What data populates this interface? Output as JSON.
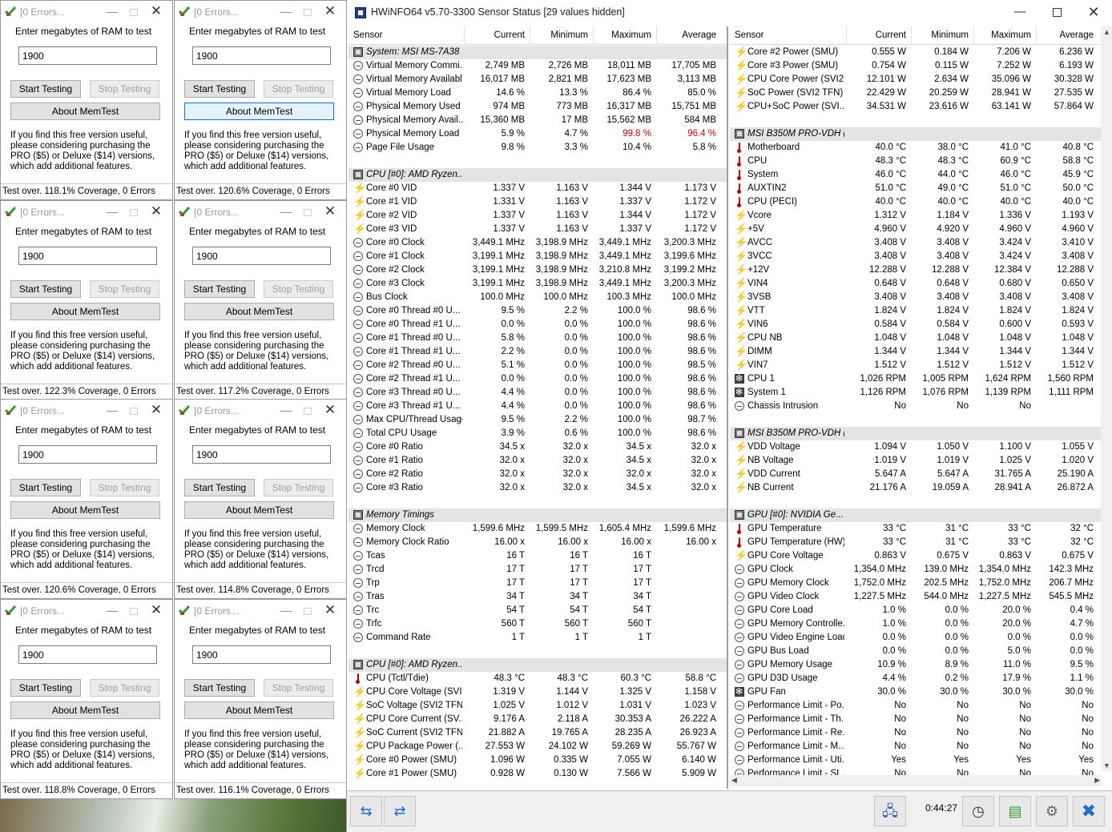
{
  "memtest": {
    "title": "[0 Errors...",
    "ram_label": "Enter megabytes of RAM to test",
    "ram_value": "1900",
    "start_label": "Start Testing",
    "stop_label": "Stop Testing",
    "about_label": "About MemTest",
    "info_text": "If you find this free version useful, please considering purchasing the PRO ($5) or Deluxe ($14) versions, which add additional features.",
    "windows": [
      {
        "status": "Test over. 118.1% Coverage, 0 Errors"
      },
      {
        "status": "Test over. 120.6% Coverage, 0 Errors"
      },
      {
        "status": "Test over. 122.3% Coverage, 0 Errors"
      },
      {
        "status": "Test over. 117.2% Coverage, 0 Errors"
      },
      {
        "status": "Test over. 120.6% Coverage, 0 Errors"
      },
      {
        "status": "Test over. 114.8% Coverage, 0 Errors"
      },
      {
        "status": "Test over. 118.8% Coverage, 0 Errors"
      },
      {
        "status": "Test over. 116.1% Coverage, 0 Errors"
      }
    ]
  },
  "hwinfo": {
    "title": "HWiNFO64 v5.70-3300 Sensor Status [29 values hidden]",
    "columns": [
      "Sensor",
      "Current",
      "Minimum",
      "Maximum",
      "Average"
    ],
    "elapsed": "0:44:27",
    "left_rows": [
      {
        "type": "group",
        "name": "System: MSI MS-7A38"
      },
      {
        "icon": "clock",
        "name": "Virtual Memory Commi...",
        "cur": "2,749 MB",
        "min": "2,726 MB",
        "max": "18,011 MB",
        "avg": "17,705 MB"
      },
      {
        "icon": "clock",
        "name": "Virtual Memory Available",
        "cur": "16,017 MB",
        "min": "2,821 MB",
        "max": "17,623 MB",
        "avg": "3,113 MB"
      },
      {
        "icon": "clock",
        "name": "Virtual Memory Load",
        "cur": "14.6 %",
        "min": "13.3 %",
        "max": "86.4 %",
        "avg": "85.0 %"
      },
      {
        "icon": "clock",
        "name": "Physical Memory Used",
        "cur": "974 MB",
        "min": "773 MB",
        "max": "16,317 MB",
        "avg": "15,751 MB"
      },
      {
        "icon": "clock",
        "name": "Physical Memory Avail...",
        "cur": "15,360 MB",
        "min": "17 MB",
        "max": "15,562 MB",
        "avg": "584 MB"
      },
      {
        "icon": "clock",
        "name": "Physical Memory Load",
        "cur": "5.9 %",
        "min": "4.7 %",
        "max": "99.8 %",
        "avg": "96.4 %",
        "red": true
      },
      {
        "icon": "clock",
        "name": "Page File Usage",
        "cur": "9.8 %",
        "min": "3.3 %",
        "max": "10.4 %",
        "avg": "5.8 %"
      },
      {
        "type": "blank"
      },
      {
        "type": "group",
        "name": "CPU [#0]: AMD Ryzen..."
      },
      {
        "icon": "bolt",
        "name": "Core #0 VID",
        "cur": "1.337 V",
        "min": "1.163 V",
        "max": "1.344 V",
        "avg": "1.173 V"
      },
      {
        "icon": "bolt",
        "name": "Core #1 VID",
        "cur": "1.331 V",
        "min": "1.163 V",
        "max": "1.337 V",
        "avg": "1.172 V"
      },
      {
        "icon": "bolt",
        "name": "Core #2 VID",
        "cur": "1.337 V",
        "min": "1.163 V",
        "max": "1.344 V",
        "avg": "1.172 V"
      },
      {
        "icon": "bolt",
        "name": "Core #3 VID",
        "cur": "1.337 V",
        "min": "1.163 V",
        "max": "1.337 V",
        "avg": "1.172 V"
      },
      {
        "icon": "clock",
        "name": "Core #0 Clock",
        "cur": "3,449.1 MHz",
        "min": "3,198.9 MHz",
        "max": "3,449.1 MHz",
        "avg": "3,200.3 MHz"
      },
      {
        "icon": "clock",
        "name": "Core #1 Clock",
        "cur": "3,199.1 MHz",
        "min": "3,198.9 MHz",
        "max": "3,449.1 MHz",
        "avg": "3,199.6 MHz"
      },
      {
        "icon": "clock",
        "name": "Core #2 Clock",
        "cur": "3,199.1 MHz",
        "min": "3,198.9 MHz",
        "max": "3,210.8 MHz",
        "avg": "3,199.2 MHz"
      },
      {
        "icon": "clock",
        "name": "Core #3 Clock",
        "cur": "3,199.1 MHz",
        "min": "3,198.9 MHz",
        "max": "3,449.1 MHz",
        "avg": "3,200.3 MHz"
      },
      {
        "icon": "clock",
        "name": "Bus Clock",
        "cur": "100.0 MHz",
        "min": "100.0 MHz",
        "max": "100.3 MHz",
        "avg": "100.0 MHz"
      },
      {
        "icon": "clock",
        "name": "Core #0 Thread #0 U...",
        "cur": "9.5 %",
        "min": "2.2 %",
        "max": "100.0 %",
        "avg": "98.6 %"
      },
      {
        "icon": "clock",
        "name": "Core #0 Thread #1 U...",
        "cur": "0.0 %",
        "min": "0.0 %",
        "max": "100.0 %",
        "avg": "98.6 %"
      },
      {
        "icon": "clock",
        "name": "Core #1 Thread #0 U...",
        "cur": "5.8 %",
        "min": "0.0 %",
        "max": "100.0 %",
        "avg": "98.6 %"
      },
      {
        "icon": "clock",
        "name": "Core #1 Thread #1 U...",
        "cur": "2.2 %",
        "min": "0.0 %",
        "max": "100.0 %",
        "avg": "98.6 %"
      },
      {
        "icon": "clock",
        "name": "Core #2 Thread #0 U...",
        "cur": "5.1 %",
        "min": "0.0 %",
        "max": "100.0 %",
        "avg": "98.5 %"
      },
      {
        "icon": "clock",
        "name": "Core #2 Thread #1 U...",
        "cur": "0.0 %",
        "min": "0.0 %",
        "max": "100.0 %",
        "avg": "98.6 %"
      },
      {
        "icon": "clock",
        "name": "Core #3 Thread #0 U...",
        "cur": "4.4 %",
        "min": "0.0 %",
        "max": "100.0 %",
        "avg": "98.6 %"
      },
      {
        "icon": "clock",
        "name": "Core #3 Thread #1 U...",
        "cur": "4.4 %",
        "min": "0.0 %",
        "max": "100.0 %",
        "avg": "98.6 %"
      },
      {
        "icon": "clock",
        "name": "Max CPU/Thread Usage",
        "cur": "9.5 %",
        "min": "2.2 %",
        "max": "100.0 %",
        "avg": "98.7 %"
      },
      {
        "icon": "clock",
        "name": "Total CPU Usage",
        "cur": "3.9 %",
        "min": "0.6 %",
        "max": "100.0 %",
        "avg": "98.6 %"
      },
      {
        "icon": "clock",
        "name": "Core #0 Ratio",
        "cur": "34.5 x",
        "min": "32.0 x",
        "max": "34.5 x",
        "avg": "32.0 x"
      },
      {
        "icon": "clock",
        "name": "Core #1 Ratio",
        "cur": "32.0 x",
        "min": "32.0 x",
        "max": "34.5 x",
        "avg": "32.0 x"
      },
      {
        "icon": "clock",
        "name": "Core #2 Ratio",
        "cur": "32.0 x",
        "min": "32.0 x",
        "max": "32.0 x",
        "avg": "32.0 x"
      },
      {
        "icon": "clock",
        "name": "Core #3 Ratio",
        "cur": "32.0 x",
        "min": "32.0 x",
        "max": "34.5 x",
        "avg": "32.0 x"
      },
      {
        "type": "blank"
      },
      {
        "type": "group",
        "name": "Memory Timings"
      },
      {
        "icon": "clock",
        "name": "Memory Clock",
        "cur": "1,599.6 MHz",
        "min": "1,599.5 MHz",
        "max": "1,605.4 MHz",
        "avg": "1,599.6 MHz"
      },
      {
        "icon": "clock",
        "name": "Memory Clock Ratio",
        "cur": "16.00 x",
        "min": "16.00 x",
        "max": "16.00 x",
        "avg": "16.00 x"
      },
      {
        "icon": "clock",
        "name": "Tcas",
        "cur": "16 T",
        "min": "16 T",
        "max": "16 T",
        "avg": ""
      },
      {
        "icon": "clock",
        "name": "Trcd",
        "cur": "17 T",
        "min": "17 T",
        "max": "17 T",
        "avg": ""
      },
      {
        "icon": "clock",
        "name": "Trp",
        "cur": "17 T",
        "min": "17 T",
        "max": "17 T",
        "avg": ""
      },
      {
        "icon": "clock",
        "name": "Tras",
        "cur": "34 T",
        "min": "34 T",
        "max": "34 T",
        "avg": ""
      },
      {
        "icon": "clock",
        "name": "Trc",
        "cur": "54 T",
        "min": "54 T",
        "max": "54 T",
        "avg": ""
      },
      {
        "icon": "clock",
        "name": "Trfc",
        "cur": "560 T",
        "min": "560 T",
        "max": "560 T",
        "avg": ""
      },
      {
        "icon": "clock",
        "name": "Command Rate",
        "cur": "1 T",
        "min": "1 T",
        "max": "1 T",
        "avg": ""
      },
      {
        "type": "blank"
      },
      {
        "type": "group",
        "name": "CPU [#0]: AMD Ryzen..."
      },
      {
        "icon": "therm",
        "name": "CPU (Tctl/Tdie)",
        "cur": "48.3 °C",
        "min": "48.3 °C",
        "max": "60.3 °C",
        "avg": "58.8 °C"
      },
      {
        "icon": "bolt",
        "name": "CPU Core Voltage (SVI...",
        "cur": "1.319 V",
        "min": "1.144 V",
        "max": "1.325 V",
        "avg": "1.158 V"
      },
      {
        "icon": "bolt",
        "name": "SoC Voltage (SVI2 TFN)",
        "cur": "1.025 V",
        "min": "1.012 V",
        "max": "1.031 V",
        "avg": "1.023 V"
      },
      {
        "icon": "bolt",
        "name": "CPU Core Current (SV...",
        "cur": "9.176 A",
        "min": "2.118 A",
        "max": "30.353 A",
        "avg": "26.222 A"
      },
      {
        "icon": "bolt",
        "name": "SoC Current (SVI2 TFN)",
        "cur": "21.882 A",
        "min": "19.765 A",
        "max": "28.235 A",
        "avg": "26.923 A"
      },
      {
        "icon": "bolt",
        "name": "CPU Package Power (...",
        "cur": "27.553 W",
        "min": "24.102 W",
        "max": "59.269 W",
        "avg": "55.767 W"
      },
      {
        "icon": "bolt",
        "name": "Core #0 Power (SMU)",
        "cur": "1.096 W",
        "min": "0.335 W",
        "max": "7.055 W",
        "avg": "6.140 W"
      },
      {
        "icon": "bolt",
        "name": "Core #1 Power (SMU)",
        "cur": "0.928 W",
        "min": "0.130 W",
        "max": "7.566 W",
        "avg": "5.909 W"
      }
    ],
    "right_rows": [
      {
        "icon": "bolt",
        "name": "Core #2 Power (SMU)",
        "cur": "0.555 W",
        "min": "0.184 W",
        "max": "7.206 W",
        "avg": "6.236 W"
      },
      {
        "icon": "bolt",
        "name": "Core #3 Power (SMU)",
        "cur": "0.754 W",
        "min": "0.115 W",
        "max": "7.252 W",
        "avg": "6.193 W"
      },
      {
        "icon": "bolt",
        "name": "CPU Core Power (SVI2...",
        "cur": "12.101 W",
        "min": "2.634 W",
        "max": "35.096 W",
        "avg": "30.328 W"
      },
      {
        "icon": "bolt",
        "name": "SoC Power (SVI2 TFN)",
        "cur": "22.429 W",
        "min": "20.259 W",
        "max": "28.941 W",
        "avg": "27.535 W"
      },
      {
        "icon": "bolt",
        "name": "CPU+SoC Power (SVI...",
        "cur": "34.531 W",
        "min": "23.616 W",
        "max": "63.141 W",
        "avg": "57.864 W"
      },
      {
        "type": "blank"
      },
      {
        "type": "group",
        "name": "MSI B350M PRO-VDH (..."
      },
      {
        "icon": "therm",
        "name": "Motherboard",
        "cur": "40.0 °C",
        "min": "38.0 °C",
        "max": "41.0 °C",
        "avg": "40.8 °C"
      },
      {
        "icon": "therm",
        "name": "CPU",
        "cur": "48.3 °C",
        "min": "48.3 °C",
        "max": "60.9 °C",
        "avg": "58.8 °C"
      },
      {
        "icon": "therm",
        "name": "System",
        "cur": "46.0 °C",
        "min": "44.0 °C",
        "max": "46.0 °C",
        "avg": "45.9 °C"
      },
      {
        "icon": "therm",
        "name": "AUXTIN2",
        "cur": "51.0 °C",
        "min": "49.0 °C",
        "max": "51.0 °C",
        "avg": "50.0 °C"
      },
      {
        "icon": "therm",
        "name": "CPU (PECI)",
        "cur": "40.0 °C",
        "min": "40.0 °C",
        "max": "40.0 °C",
        "avg": "40.0 °C"
      },
      {
        "icon": "bolt",
        "name": "Vcore",
        "cur": "1.312 V",
        "min": "1.184 V",
        "max": "1.336 V",
        "avg": "1.193 V"
      },
      {
        "icon": "bolt",
        "name": "+5V",
        "cur": "4.960 V",
        "min": "4.920 V",
        "max": "4.960 V",
        "avg": "4.960 V"
      },
      {
        "icon": "bolt",
        "name": "AVCC",
        "cur": "3.408 V",
        "min": "3.408 V",
        "max": "3.424 V",
        "avg": "3.410 V"
      },
      {
        "icon": "bolt",
        "name": "3VCC",
        "cur": "3.408 V",
        "min": "3.408 V",
        "max": "3.424 V",
        "avg": "3.408 V"
      },
      {
        "icon": "bolt",
        "name": "+12V",
        "cur": "12.288 V",
        "min": "12.288 V",
        "max": "12.384 V",
        "avg": "12.288 V"
      },
      {
        "icon": "bolt",
        "name": "VIN4",
        "cur": "0.648 V",
        "min": "0.648 V",
        "max": "0.680 V",
        "avg": "0.650 V"
      },
      {
        "icon": "bolt",
        "name": "3VSB",
        "cur": "3.408 V",
        "min": "3.408 V",
        "max": "3.408 V",
        "avg": "3.408 V"
      },
      {
        "icon": "bolt",
        "name": "VTT",
        "cur": "1.824 V",
        "min": "1.824 V",
        "max": "1.824 V",
        "avg": "1.824 V"
      },
      {
        "icon": "bolt",
        "name": "VIN6",
        "cur": "0.584 V",
        "min": "0.584 V",
        "max": "0.600 V",
        "avg": "0.593 V"
      },
      {
        "icon": "bolt",
        "name": "CPU NB",
        "cur": "1.048 V",
        "min": "1.048 V",
        "max": "1.048 V",
        "avg": "1.048 V"
      },
      {
        "icon": "bolt",
        "name": "DIMM",
        "cur": "1.344 V",
        "min": "1.344 V",
        "max": "1.344 V",
        "avg": "1.344 V"
      },
      {
        "icon": "bolt",
        "name": "VIN7",
        "cur": "1.512 V",
        "min": "1.512 V",
        "max": "1.512 V",
        "avg": "1.512 V"
      },
      {
        "icon": "fan",
        "name": "CPU 1",
        "cur": "1,026 RPM",
        "min": "1,005 RPM",
        "max": "1,624 RPM",
        "avg": "1,560 RPM"
      },
      {
        "icon": "fan",
        "name": "System 1",
        "cur": "1,126 RPM",
        "min": "1,076 RPM",
        "max": "1,139 RPM",
        "avg": "1,111 RPM"
      },
      {
        "icon": "clock",
        "name": "Chassis Intrusion",
        "cur": "No",
        "min": "No",
        "max": "No",
        "avg": ""
      },
      {
        "type": "blank"
      },
      {
        "type": "group",
        "name": "MSI B350M PRO-VDH (..."
      },
      {
        "icon": "bolt",
        "name": "VDD Voltage",
        "cur": "1.094 V",
        "min": "1.050 V",
        "max": "1.100 V",
        "avg": "1.055 V"
      },
      {
        "icon": "bolt",
        "name": "NB Voltage",
        "cur": "1.019 V",
        "min": "1.019 V",
        "max": "1.025 V",
        "avg": "1.020 V"
      },
      {
        "icon": "bolt",
        "name": "VDD Current",
        "cur": "5.647 A",
        "min": "5.647 A",
        "max": "31.765 A",
        "avg": "25.190 A"
      },
      {
        "icon": "bolt",
        "name": "NB Current",
        "cur": "21.176 A",
        "min": "19.059 A",
        "max": "28.941 A",
        "avg": "26.872 A"
      },
      {
        "type": "blank"
      },
      {
        "type": "group",
        "name": "GPU [#0]: NVIDIA Ge..."
      },
      {
        "icon": "therm",
        "name": "GPU Temperature",
        "cur": "33 °C",
        "min": "31 °C",
        "max": "33 °C",
        "avg": "32 °C"
      },
      {
        "icon": "therm",
        "name": "GPU Temperature (HW)",
        "cur": "33 °C",
        "min": "31 °C",
        "max": "33 °C",
        "avg": "32 °C"
      },
      {
        "icon": "bolt",
        "name": "GPU Core Voltage",
        "cur": "0.863 V",
        "min": "0.675 V",
        "max": "0.863 V",
        "avg": "0.675 V"
      },
      {
        "icon": "clock",
        "name": "GPU Clock",
        "cur": "1,354.0 MHz",
        "min": "139.0 MHz",
        "max": "1,354.0 MHz",
        "avg": "142.3 MHz"
      },
      {
        "icon": "clock",
        "name": "GPU Memory Clock",
        "cur": "1,752.0 MHz",
        "min": "202.5 MHz",
        "max": "1,752.0 MHz",
        "avg": "206.7 MHz"
      },
      {
        "icon": "clock",
        "name": "GPU Video Clock",
        "cur": "1,227.5 MHz",
        "min": "544.0 MHz",
        "max": "1,227.5 MHz",
        "avg": "545.5 MHz"
      },
      {
        "icon": "clock",
        "name": "GPU Core Load",
        "cur": "1.0 %",
        "min": "0.0 %",
        "max": "20.0 %",
        "avg": "0.4 %"
      },
      {
        "icon": "clock",
        "name": "GPU Memory Controlle...",
        "cur": "1.0 %",
        "min": "0.0 %",
        "max": "20.0 %",
        "avg": "4.7 %"
      },
      {
        "icon": "clock",
        "name": "GPU Video Engine Load",
        "cur": "0.0 %",
        "min": "0.0 %",
        "max": "0.0 %",
        "avg": "0.0 %"
      },
      {
        "icon": "clock",
        "name": "GPU Bus Load",
        "cur": "0.0 %",
        "min": "0.0 %",
        "max": "5.0 %",
        "avg": "0.0 %"
      },
      {
        "icon": "clock",
        "name": "GPU Memory Usage",
        "cur": "10.9 %",
        "min": "8.9 %",
        "max": "11.0 %",
        "avg": "9.5 %"
      },
      {
        "icon": "clock",
        "name": "GPU D3D Usage",
        "cur": "4.4 %",
        "min": "0.2 %",
        "max": "17.9 %",
        "avg": "1.1 %"
      },
      {
        "icon": "fan",
        "name": "GPU Fan",
        "cur": "30.0 %",
        "min": "30.0 %",
        "max": "30.0 %",
        "avg": "30.0 %"
      },
      {
        "icon": "clock",
        "name": "Performance Limit - Po...",
        "cur": "No",
        "min": "No",
        "max": "No",
        "avg": "No"
      },
      {
        "icon": "clock",
        "name": "Performance Limit - Th...",
        "cur": "No",
        "min": "No",
        "max": "No",
        "avg": "No"
      },
      {
        "icon": "clock",
        "name": "Performance Limit - Re...",
        "cur": "No",
        "min": "No",
        "max": "No",
        "avg": "No"
      },
      {
        "icon": "clock",
        "name": "Performance Limit - M...",
        "cur": "No",
        "min": "No",
        "max": "No",
        "avg": "No"
      },
      {
        "icon": "clock",
        "name": "Performance Limit - Uti...",
        "cur": "Yes",
        "min": "Yes",
        "max": "Yes",
        "avg": "Yes"
      },
      {
        "icon": "clock",
        "name": "Performance Limit - SL...",
        "cur": "No",
        "min": "No",
        "max": "No",
        "avg": "No"
      }
    ]
  }
}
